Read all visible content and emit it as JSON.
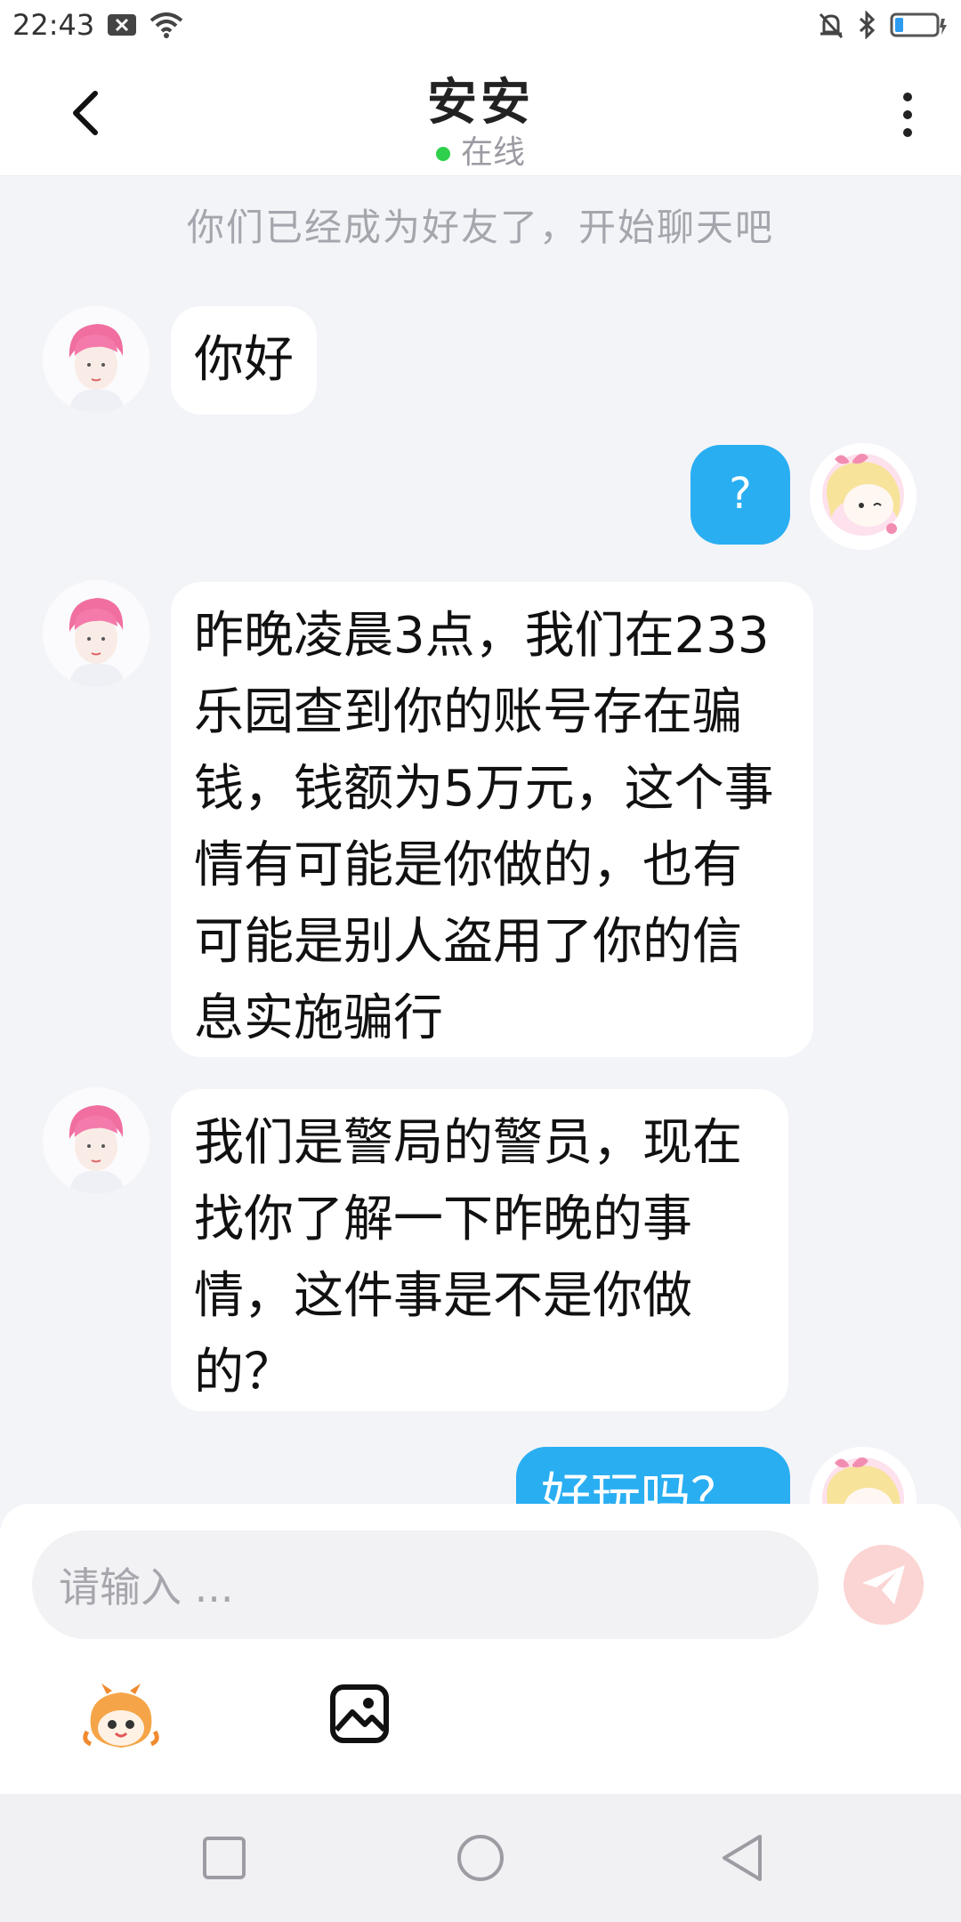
{
  "status_bar": {
    "time": "22:43",
    "icons": [
      "notification-x-icon",
      "wifi-icon",
      "mute-bell-icon",
      "bluetooth-icon",
      "battery-icon"
    ],
    "battery_color": "#2d9cf0"
  },
  "header": {
    "title": "安安",
    "status": "在线",
    "status_color": "#2ecf4b"
  },
  "chat": {
    "system_note": "你们已经成为好友了，开始聊天吧",
    "messages": [
      {
        "side": "in",
        "text": "你好"
      },
      {
        "side": "out",
        "text": "?"
      },
      {
        "side": "in",
        "text": "昨晚凌晨3点，我们在233乐园查到你的账号存在骗钱，钱额为5万元，这个事情有可能是你做的，也有可能是别人盗用了你的信息实施骗行"
      },
      {
        "side": "in",
        "text": "我们是警局的警员，现在找你了解一下昨晚的事情，这件事是不是你做的？"
      },
      {
        "side": "out",
        "text": "好玩吗？"
      }
    ]
  },
  "input": {
    "placeholder": "请输入 ...",
    "send_icon": "send-plane-icon",
    "tools": [
      "emoji-mascot-icon",
      "image-icon"
    ]
  },
  "colors": {
    "outgoing_bubble": "#29aef2",
    "incoming_bubble": "#ffffff",
    "chat_background": "#f3f4f8"
  },
  "nav": [
    "recent-apps-icon",
    "home-icon",
    "back-triangle-icon"
  ]
}
